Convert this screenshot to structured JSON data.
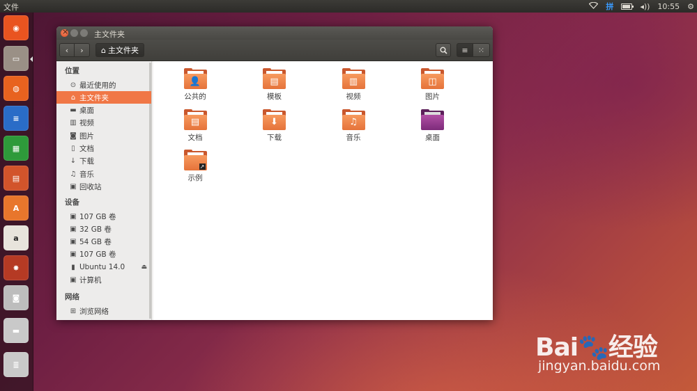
{
  "top_panel": {
    "app_title": "文件",
    "ime_label": "拼",
    "clock": "10:55",
    "icons": [
      "wifi-icon",
      "ime-icon",
      "battery-icon",
      "volume-icon",
      "gear-icon"
    ]
  },
  "launcher": {
    "items": [
      {
        "name": "ubuntu-dash",
        "color": "#e95420",
        "glyph": "◉"
      },
      {
        "name": "files",
        "color": "#9a9086",
        "glyph": "▭"
      },
      {
        "name": "firefox",
        "color": "#e8621f",
        "glyph": "◍"
      },
      {
        "name": "libreoffice-writer",
        "color": "#2a6cc7",
        "glyph": "≡"
      },
      {
        "name": "libreoffice-calc",
        "color": "#2e9a3a",
        "glyph": "▦"
      },
      {
        "name": "libreoffice-impress",
        "color": "#d2542b",
        "glyph": "▤"
      },
      {
        "name": "software-center",
        "color": "#e8762c",
        "glyph": "A"
      },
      {
        "name": "amazon",
        "color": "#e8e4dc",
        "glyph": "a"
      },
      {
        "name": "system-settings",
        "color": "#b53a24",
        "glyph": "✸"
      },
      {
        "name": "shotwell",
        "color": "#bdbdbd",
        "glyph": "◙"
      },
      {
        "name": "drive",
        "color": "#c9c9c9",
        "glyph": "▬"
      },
      {
        "name": "workspaces",
        "color": "#c9c9c9",
        "glyph": "≣"
      }
    ]
  },
  "window": {
    "title": "主文件夹",
    "path_button": "主文件夹",
    "icons": {
      "back": "‹",
      "forward": "›",
      "search": "⌕",
      "list": "≡",
      "grid": "⁙",
      "home": "⌂"
    }
  },
  "sidebar": {
    "sections": [
      {
        "title": "位置",
        "items": [
          {
            "label": "最近使用的",
            "icon": "⊙",
            "name": "recent"
          },
          {
            "label": "主文件夹",
            "icon": "⌂",
            "name": "home",
            "active": true
          },
          {
            "label": "桌面",
            "icon": "▬",
            "name": "desktop"
          },
          {
            "label": "视频",
            "icon": "▥",
            "name": "videos"
          },
          {
            "label": "图片",
            "icon": "◙",
            "name": "pictures"
          },
          {
            "label": "文档",
            "icon": "▯",
            "name": "documents"
          },
          {
            "label": "下载",
            "icon": "↓",
            "name": "downloads"
          },
          {
            "label": "音乐",
            "icon": "♫",
            "name": "music"
          },
          {
            "label": "回收站",
            "icon": "▣",
            "name": "trash"
          }
        ]
      },
      {
        "title": "设备",
        "items": [
          {
            "label": "107 GB 卷",
            "icon": "▣",
            "name": "volume-107-1"
          },
          {
            "label": "32 GB 卷",
            "icon": "▣",
            "name": "volume-32"
          },
          {
            "label": "54 GB 卷",
            "icon": "▣",
            "name": "volume-54"
          },
          {
            "label": "107 GB 卷",
            "icon": "▣",
            "name": "volume-107-2"
          },
          {
            "label": "Ubuntu 14.0",
            "icon": "▮",
            "name": "ubuntu-drive",
            "eject": "⏏"
          },
          {
            "label": "计算机",
            "icon": "▣",
            "name": "computer"
          }
        ]
      },
      {
        "title": "网络",
        "items": [
          {
            "label": "浏览网络",
            "icon": "⊞",
            "name": "browse-network"
          }
        ]
      }
    ]
  },
  "files": [
    {
      "label": "公共的",
      "emblem": "👤",
      "name": "public"
    },
    {
      "label": "模板",
      "emblem": "▤",
      "name": "templates"
    },
    {
      "label": "视频",
      "emblem": "▥",
      "name": "videos"
    },
    {
      "label": "图片",
      "emblem": "◫",
      "name": "pictures"
    },
    {
      "label": "文档",
      "emblem": "▤",
      "name": "documents"
    },
    {
      "label": "下载",
      "emblem": "⬇",
      "name": "downloads"
    },
    {
      "label": "音乐",
      "emblem": "♫",
      "name": "music"
    },
    {
      "label": "桌面",
      "emblem": "",
      "name": "desktop",
      "desk": true
    },
    {
      "label": "示例",
      "emblem": "",
      "name": "examples",
      "link": "↗"
    }
  ],
  "watermark": {
    "logo": "Bai🐾经验",
    "url": "jingyan.baidu.com"
  },
  "colors": {
    "accent": "#f07746",
    "folder": "#e5733a",
    "panel": "#3c3b37"
  }
}
